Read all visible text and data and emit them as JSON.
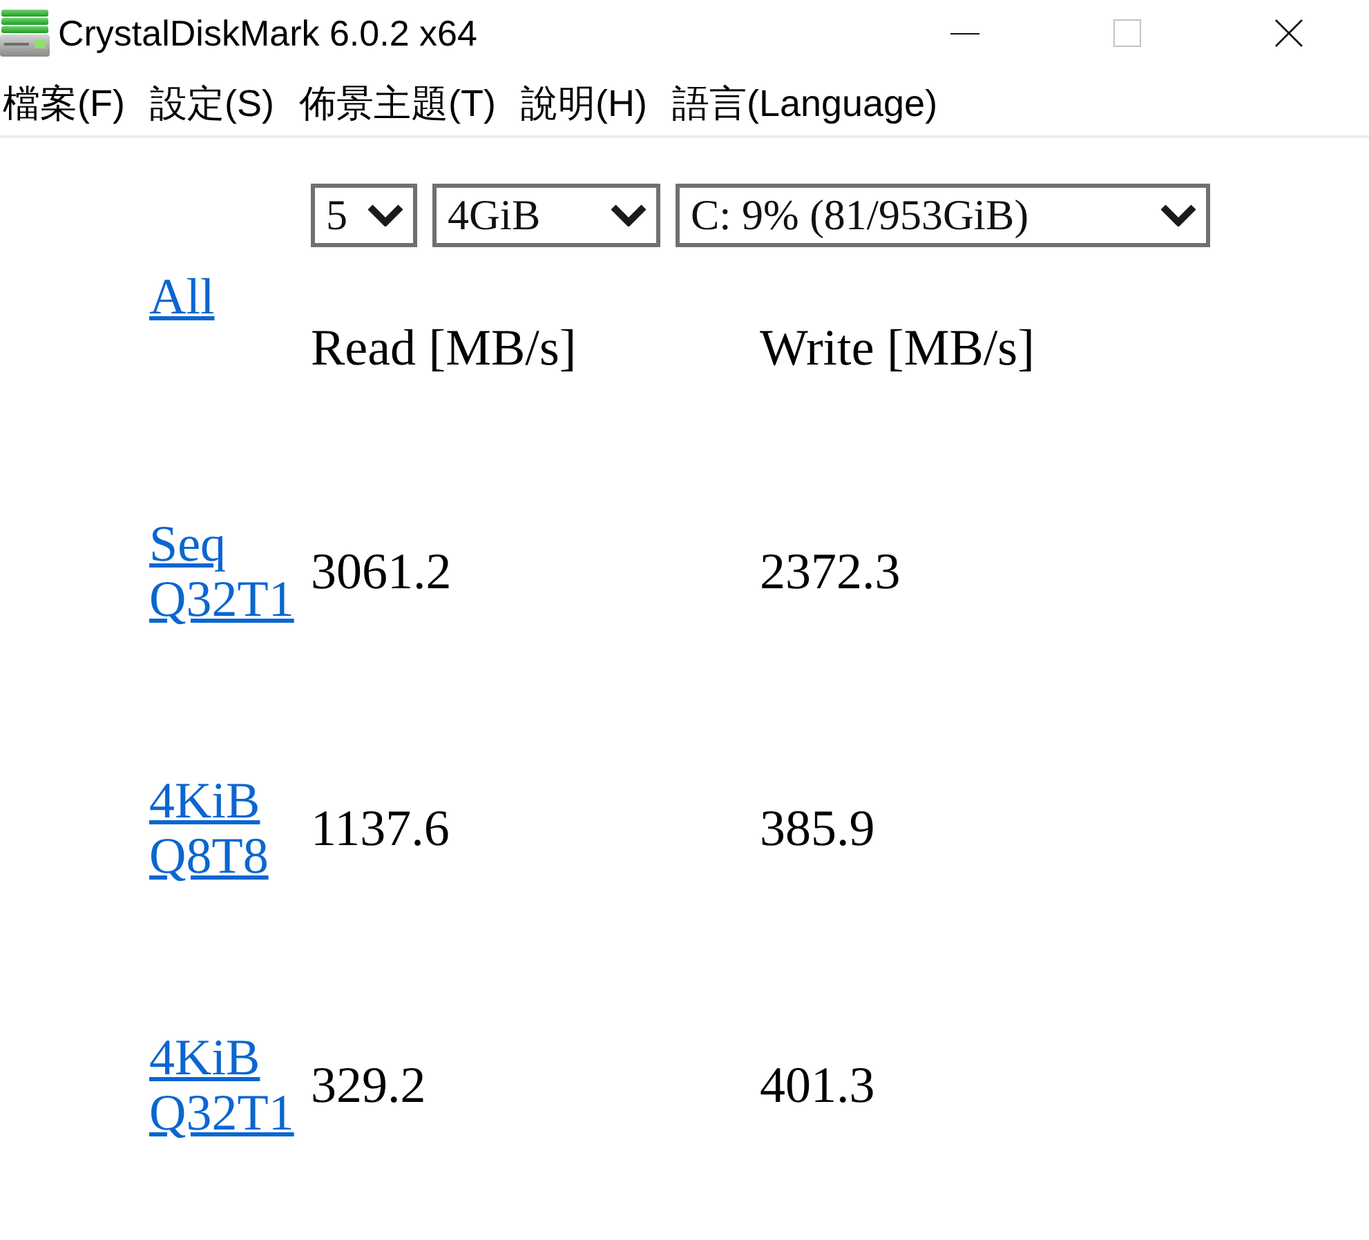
{
  "window": {
    "title": "CrystalDiskMark 6.0.2 x64",
    "controls": [
      {
        "kind": "minimize",
        "disabled": false
      },
      {
        "kind": "maximize",
        "disabled": true
      },
      {
        "kind": "close",
        "disabled": false
      }
    ]
  },
  "menu": [
    "檔案(F)",
    "設定(S)",
    "佈景主題(T)",
    "說明(H)",
    "語言(Language)"
  ],
  "settings": [
    {
      "value": "5"
    },
    {
      "value": "4GiB"
    },
    {
      "value": "C: 9% (81/953GiB)"
    }
  ],
  "results": {
    "all_link": "All",
    "columns": [
      "Read [MB/s]",
      "Write [MB/s]"
    ],
    "rows": [
      {
        "test": "Seq Q32T1",
        "read": "3061.2",
        "write": "2372.3"
      },
      {
        "test": "4KiB Q8T8",
        "read": "1137.6",
        "write": "385.9"
      },
      {
        "test": "4KiB Q32T1",
        "read": "329.2",
        "write": "401.3"
      }
    ]
  }
}
